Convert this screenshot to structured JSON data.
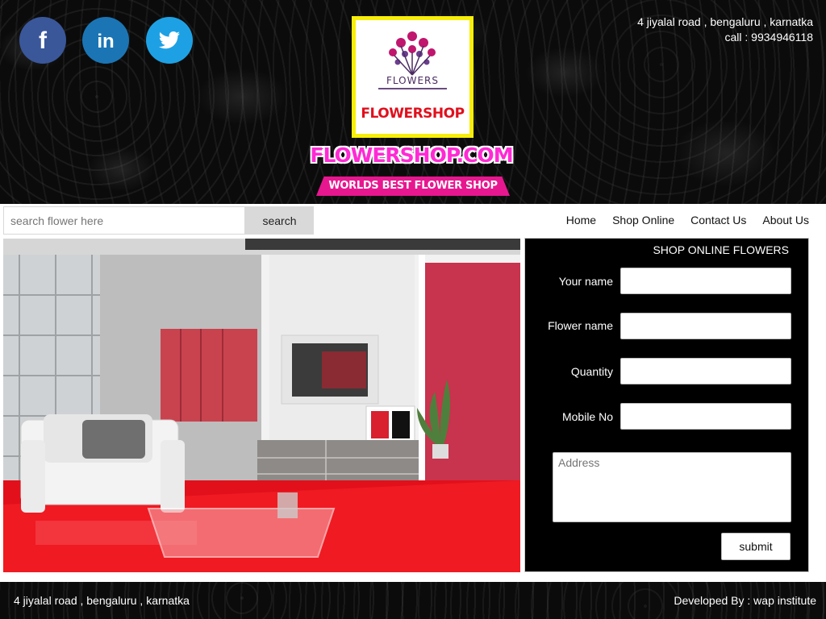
{
  "header": {
    "social": [
      {
        "name": "facebook",
        "glyph": "f",
        "color": "#3a579a"
      },
      {
        "name": "linkedin",
        "glyph": "in",
        "color": "#1b75b4"
      },
      {
        "name": "twitter",
        "glyph": "twitter-bird",
        "color": "#1ea1e4"
      }
    ],
    "logo": {
      "caption": "FLOWERS",
      "name": "FLOWERSHOP",
      "border_color": "#f7ee0a"
    },
    "brand_title": "FLOWERSHOP.COM",
    "tagline": "WORLDS BEST FLOWER SHOP",
    "address_line": "4 jiyalal road , bengaluru , karnatka",
    "phone_line": "call : 9934946118"
  },
  "search": {
    "placeholder": "search flower here",
    "button_label": "search"
  },
  "nav": {
    "items": [
      "Home",
      "Shop Online",
      "Contact Us",
      "About Us"
    ]
  },
  "form": {
    "title": "SHOP ONLINE FLOWERS",
    "name_label": "Your name",
    "flower_label": "Flower name",
    "quantity_label": "Quantity",
    "mobile_label": "Mobile No",
    "address_placeholder": "Address",
    "submit_label": "submit"
  },
  "footer": {
    "address": "4 jiyalal road , bengaluru , karnatka",
    "credit": "Developed By : wap institute"
  },
  "colors": {
    "brand_pink": "#ff2ad4",
    "tagline_bg": "#e7178f",
    "logo_red": "#e0101d"
  }
}
